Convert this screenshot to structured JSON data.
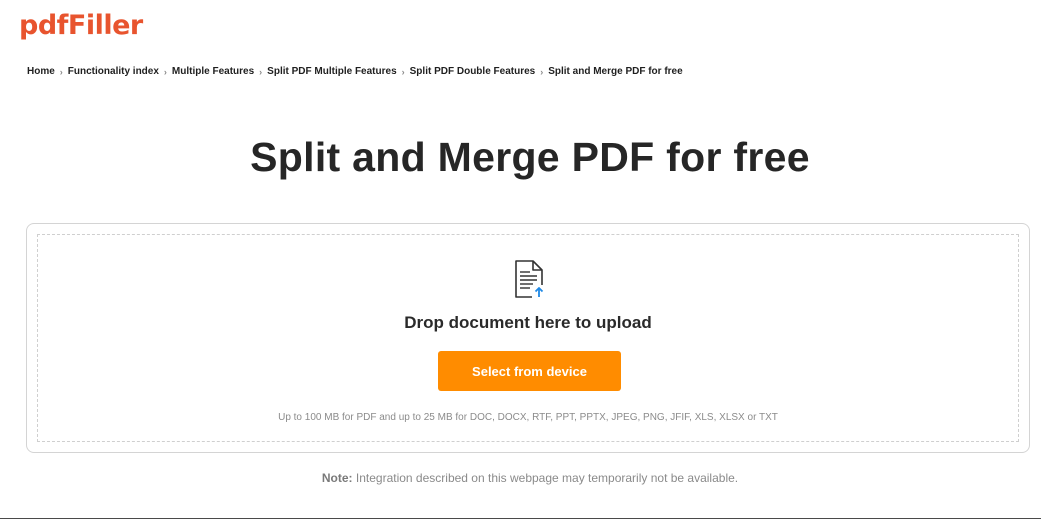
{
  "brand": {
    "logo_text": "pdfFiller",
    "color": "#e8542e"
  },
  "breadcrumb": {
    "items": [
      "Home",
      "Functionality index",
      "Multiple Features",
      "Split PDF Multiple Features",
      "Split PDF Double Features",
      "Split and Merge PDF for free"
    ],
    "separator": "›"
  },
  "page": {
    "title": "Split and Merge PDF for free"
  },
  "upload": {
    "icon": "document-upload-icon",
    "drop_text": "Drop document here to upload",
    "button_label": "Select from device",
    "button_color": "#ff8c00",
    "size_info": "Up to 100 MB for PDF and up to 25 MB for DOC, DOCX, RTF, PPT, PPTX, JPEG, PNG, JFIF, XLS, XLSX or TXT"
  },
  "note": {
    "label": "Note:",
    "text": "Integration described on this webpage may temporarily not be available."
  }
}
